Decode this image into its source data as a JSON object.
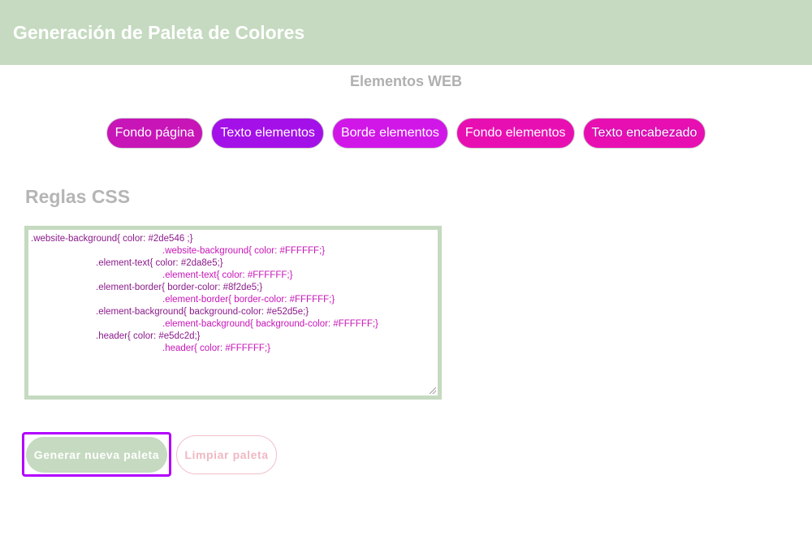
{
  "header": {
    "title": "Generación de Paleta de Colores",
    "bg_color": "#c5dac0"
  },
  "section_title": "Elementos WEB",
  "chips": [
    {
      "label": "Fondo página",
      "color": "#c715b7"
    },
    {
      "label": "Texto elementos",
      "color": "#a410e8"
    },
    {
      "label": "Borde elementos",
      "color": "#d117e8"
    },
    {
      "label": "Fondo elementos",
      "color": "#e80fb2"
    },
    {
      "label": "Texto encabezado",
      "color": "#e80fb2"
    }
  ],
  "rules": {
    "title": "Reglas CSS",
    "lines": [
      {
        "text": ".website-background{ color: #2de546 ;}",
        "indent": 0,
        "color": "#8b1a8b"
      },
      {
        "text": ".website-background{ color: #FFFFFF;}",
        "indent": 2,
        "color": "#c715b7"
      },
      {
        "text": ".element-text{ color: #2da8e5;}",
        "indent": 1,
        "color": "#8b1a8b"
      },
      {
        "text": ".element-text{ color: #FFFFFF;}",
        "indent": 2,
        "color": "#c715b7"
      },
      {
        "text": ".element-border{ border-color: #8f2de5;}",
        "indent": 1,
        "color": "#8b1a8b"
      },
      {
        "text": ".element-border{ border-color: #FFFFFF;}",
        "indent": 2,
        "color": "#c715b7"
      },
      {
        "text": ".element-background{ background-color: #e52d5e;}",
        "indent": 1,
        "color": "#8b1a8b"
      },
      {
        "text": ".element-background{ background-color: #FFFFFF;}",
        "indent": 2,
        "color": "#c715b7"
      },
      {
        "text": ".header{ color: #e5dc2d;}",
        "indent": 1,
        "color": "#8b1a8b"
      },
      {
        "text": ".header{ color: #FFFFFF;}",
        "indent": 2,
        "color": "#c715b7"
      }
    ]
  },
  "actions": {
    "generate_label": "Generar nueva paleta",
    "clear_label": "Limpiar paleta"
  }
}
